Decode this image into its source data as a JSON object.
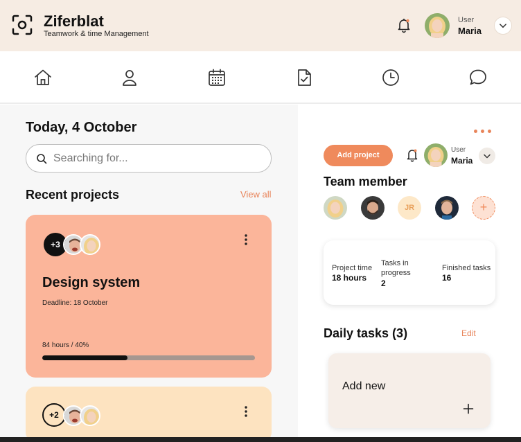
{
  "header": {
    "brand_title": "Ziferblat",
    "brand_subtitle": "Teamwork & time Management",
    "user_label": "User",
    "user_name": "Maria"
  },
  "nav": {
    "icons": [
      "home-icon",
      "profile-icon",
      "calendar-icon",
      "document-check-icon",
      "clock-icon",
      "chat-icon"
    ]
  },
  "main": {
    "today": "Today, 4 October",
    "search_placeholder": "Searching for...",
    "recent_title": "Recent projects",
    "view_all": "View all",
    "projects": [
      {
        "extra_members": "+3",
        "title": "Design system",
        "deadline": "Deadline: 18 October",
        "hours": "84 hours / 40%",
        "progress_percent": 40,
        "color": "#fbb59a"
      },
      {
        "extra_members": "+2",
        "color": "#fde3c0"
      }
    ]
  },
  "side": {
    "add_project": "Add project",
    "user_label": "User",
    "user_name": "Maria",
    "team_title": "Team member",
    "team_initials": "JR",
    "add_member": "+",
    "stats": [
      {
        "label": "Project time",
        "value": "18 hours"
      },
      {
        "label": "Tasks in progress",
        "value": "2"
      },
      {
        "label": "Finished tasks",
        "value": "16"
      }
    ],
    "daily_title": "Daily tasks (3)",
    "edit": "Edit",
    "add_new": "Add new"
  },
  "colors": {
    "accent": "#ef8a5c",
    "header_bg": "#f6ece3",
    "card_primary": "#fbb59a",
    "card_secondary": "#fde3c0"
  }
}
